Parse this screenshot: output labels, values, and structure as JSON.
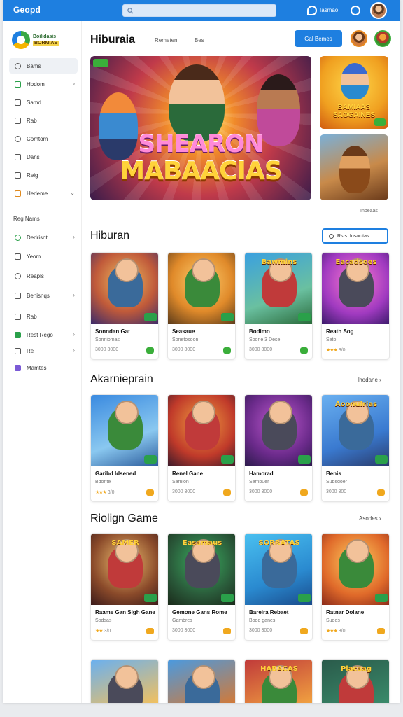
{
  "topbar": {
    "brand": "Geopd",
    "search_placeholder": "",
    "user_label": "Iasmao"
  },
  "sidebar": {
    "logo_line1": "Boilidasis",
    "logo_line2": "BORMIAS",
    "items": [
      {
        "label": "Bams"
      },
      {
        "label": "Hodom"
      },
      {
        "label": "Samd"
      },
      {
        "label": "Rab"
      },
      {
        "label": "Comtom"
      },
      {
        "label": "Dans"
      },
      {
        "label": "Reig"
      },
      {
        "label": "Hedeme"
      }
    ],
    "section_label": "Reg Nams",
    "items2": [
      {
        "label": "Dedrisnt"
      },
      {
        "label": "Yeom"
      },
      {
        "label": "Reapls"
      },
      {
        "label": "Benisnqs"
      },
      {
        "label": "Rab"
      },
      {
        "label": "Rest Rego"
      },
      {
        "label": "Re"
      },
      {
        "label": "Mamtes"
      }
    ]
  },
  "header": {
    "title": "Hiburaia",
    "link1": "Remeten",
    "link2": "Bes",
    "button": "Gal Bemes"
  },
  "hero": {
    "title_line1": "SHEARON",
    "title_line2": "MABAACIAS",
    "side1_text": "BAMIAAS SAOGAINES",
    "more_link": "Inbeaas"
  },
  "sections": [
    {
      "title": "Hiburan",
      "action": "Rsts. Insacitas",
      "cards": [
        {
          "thumb_title": "",
          "name": "Sonndan Gat",
          "sub": "Sonniomas",
          "meta": "3000 3000",
          "badge": "green"
        },
        {
          "thumb_title": "",
          "name": "Seasaue",
          "sub": "Sonetosoon",
          "meta": "3000 3000",
          "badge": "green"
        },
        {
          "thumb_title": "Bawmins",
          "name": "Bodimo",
          "sub": "Soone 3 Dese",
          "meta": "3000 3000",
          "badge": "green"
        },
        {
          "thumb_title": "Eacadsoes",
          "name": "Reath Sog",
          "sub": "Seto",
          "meta": "3/0",
          "badge": "none",
          "stars": "★★★"
        }
      ]
    },
    {
      "title": "Akarnieprain",
      "action": "Ihodane",
      "cards": [
        {
          "thumb_title": "",
          "name": "Garibd Idsened",
          "sub": "Bdonte",
          "meta": "3/0",
          "badge": "amber",
          "stars": "★★★"
        },
        {
          "thumb_title": "",
          "name": "Renel Gane",
          "sub": "Samion",
          "meta": "3000 3000",
          "badge": "amber"
        },
        {
          "thumb_title": "",
          "name": "Hamorad",
          "sub": "Sembuer",
          "meta": "3000 3000",
          "badge": "amber"
        },
        {
          "thumb_title": "Aoonulrias",
          "name": "Benis",
          "sub": "Subsdoer",
          "meta": "3000 300",
          "badge": "amber"
        }
      ]
    },
    {
      "title": "Riolign Game",
      "action": "Asodes",
      "cards": [
        {
          "thumb_title": "SAMER",
          "name": "Raame Gan Sigh Gane",
          "sub": "Sodsas",
          "meta": "3/0",
          "badge": "amber",
          "stars": "★★"
        },
        {
          "thumb_title": "Easamaus",
          "name": "Gemone Gans Rome",
          "sub": "Gambres",
          "meta": "3000 3000",
          "badge": "amber"
        },
        {
          "thumb_title": "SORRATAS",
          "name": "Bareira Rebaet",
          "sub": "Bodd ganes",
          "meta": "3000 3000",
          "badge": "amber"
        },
        {
          "thumb_title": "",
          "name": "Ratnar Dolane",
          "sub": "Sudes",
          "meta": "3/0",
          "badge": "amber",
          "stars": "★★★"
        }
      ]
    },
    {
      "title": "",
      "action": "",
      "cards": [
        {
          "thumb_title": "",
          "name": "",
          "sub": "",
          "meta": "",
          "badge": "none"
        },
        {
          "thumb_title": "",
          "name": "",
          "sub": "",
          "meta": "",
          "badge": "none"
        },
        {
          "thumb_title": "HABACAS",
          "name": "",
          "sub": "",
          "meta": "",
          "badge": "none"
        },
        {
          "thumb_title": "Placaag",
          "name": "",
          "sub": "",
          "meta": "",
          "badge": "none"
        }
      ]
    }
  ],
  "colors": {
    "accent": "#1e7fe0",
    "green_badge": "#3aae3a",
    "amber_badge": "#f0a81e"
  }
}
